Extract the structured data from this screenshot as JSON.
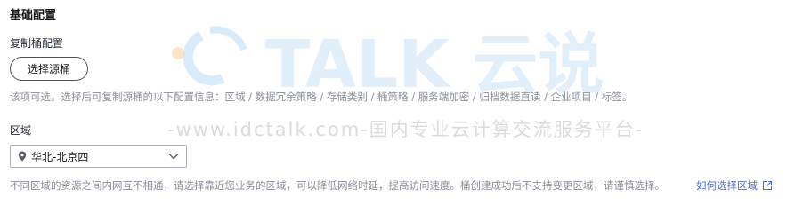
{
  "section": {
    "title": "基础配置"
  },
  "copy_source": {
    "label": "复制桶配置",
    "button_label": "选择源桶",
    "hint": "该项可选。选择后可复制源桶的以下配置信息：区域 / 数据冗余策略 / 存储类别 / 桶策略 / 服务端加密 / 归档数据直读 / 企业项目 / 标签。"
  },
  "region": {
    "label": "区域",
    "selected": "华北-北京四",
    "pin_icon": "location-pin-icon",
    "dropdown_icon": "chevron-down-icon",
    "hint": "不同区域的资源之间内网互不相通，请选择靠近您业务的区域，可以降低网络时延，提高访问速度。桶创建成功后不支持变更区域，请谨慎选择。",
    "help_link": "如何选择区域",
    "help_link_icon": "external-link-icon"
  },
  "watermark": {
    "logo_text": "TALK 云说",
    "url_text": "-www.idctalk.com-国内专业云计算交流服务平台-"
  },
  "colors": {
    "link": "#526ecc",
    "hint": "#8a8e99",
    "text": "#252b3a"
  }
}
